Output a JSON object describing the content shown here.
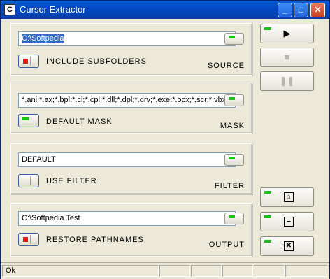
{
  "window": {
    "title": "Cursor Extractor",
    "icon": "cursor-extractor-icon"
  },
  "title_buttons": {
    "minimize": "_",
    "maximize": "□",
    "close": "✕"
  },
  "source": {
    "path": "C:\\Softpedia",
    "toggle_label": "INCLUDE SUBFOLDERS",
    "group_label": "SOURCE"
  },
  "mask": {
    "value": "*.ani;*.ax;*.bpl;*.cl;*.cpl;*.dll;*.dpl;*.drv;*.exe;*.ocx;*.scr;*.vbx",
    "toggle_label": "DEFAULT MASK",
    "group_label": "MASK"
  },
  "filter": {
    "value": "DEFAULT",
    "toggle_label": "USE FILTER",
    "group_label": "FILTER"
  },
  "output": {
    "path": "C:\\Softpedia Test",
    "toggle_label": "RESTORE PATHNAMES",
    "group_label": "OUTPUT"
  },
  "controls": {
    "play": "▶",
    "stop": "■",
    "pause": "❚❚",
    "home": "⌂",
    "minimize": "–",
    "close": "✕"
  },
  "status": {
    "text": "Ok"
  },
  "colors": {
    "led_green": "#18C318",
    "led_red": "#E01818",
    "title_blue": "#0348C4"
  }
}
